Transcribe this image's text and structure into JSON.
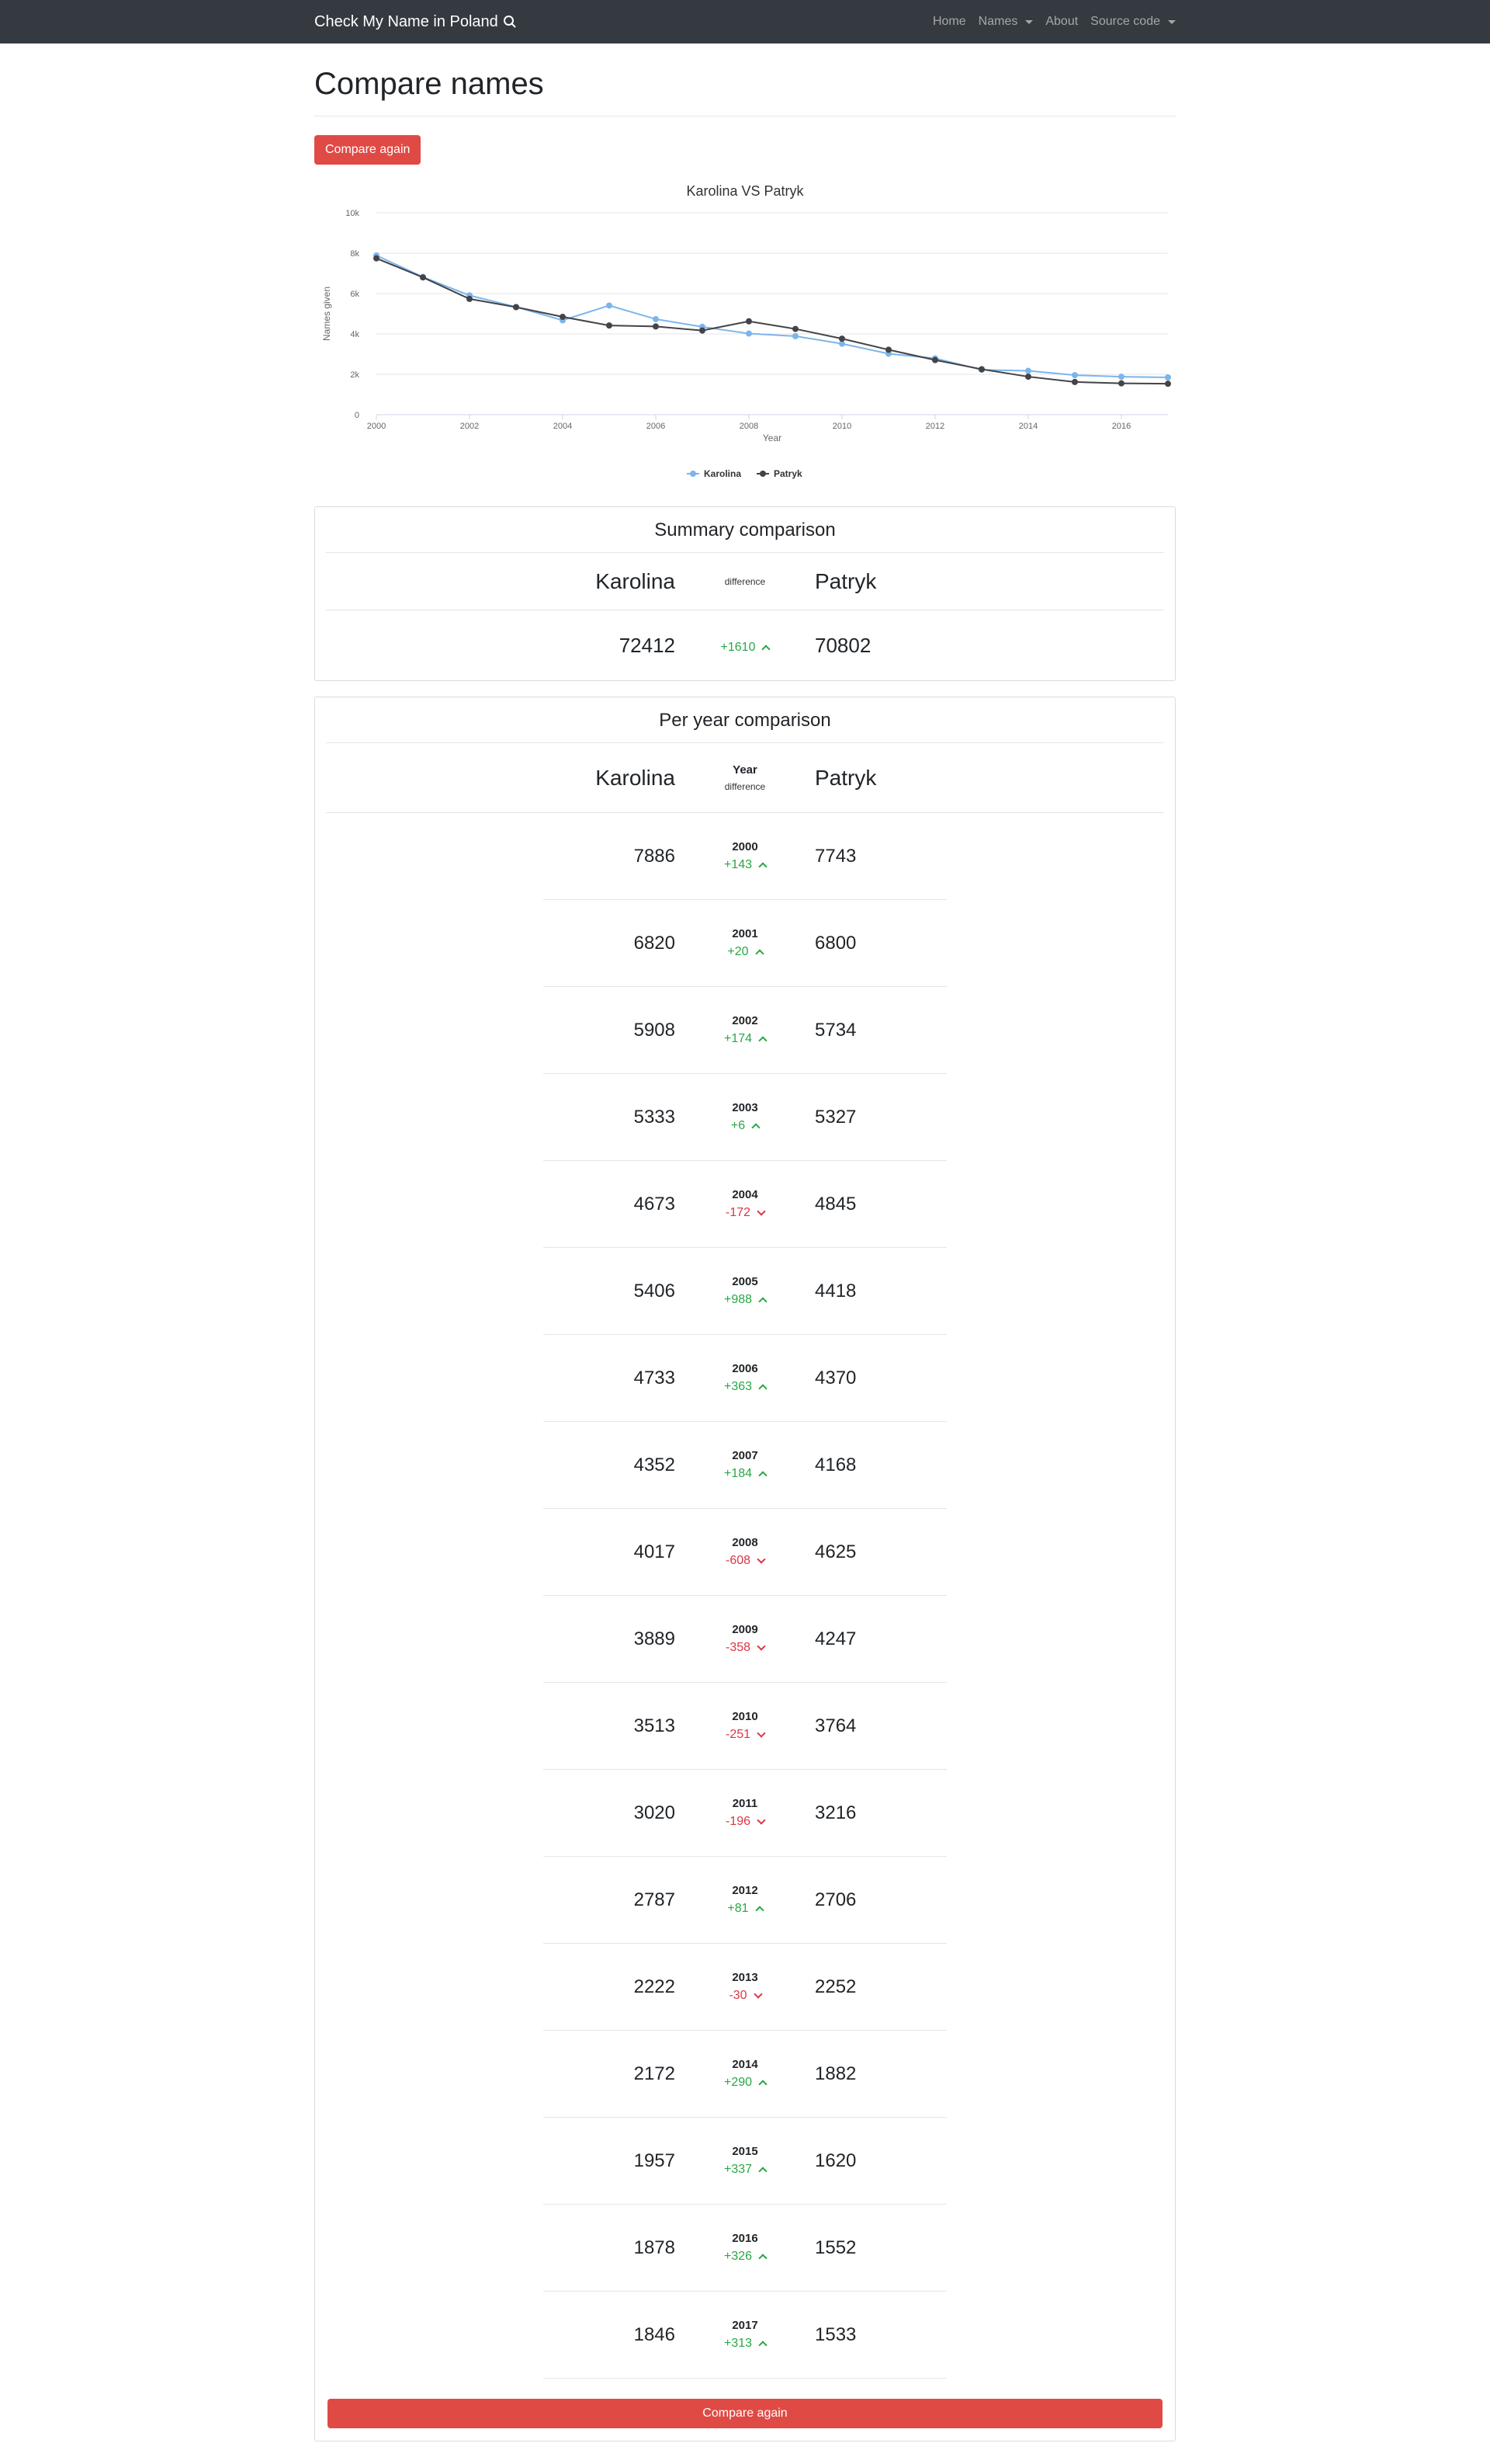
{
  "navbar": {
    "brand": "Check My Name in Poland",
    "links": [
      "Home",
      "Names",
      "About",
      "Source code"
    ]
  },
  "page": {
    "title": "Compare names",
    "compare_again": "Compare again",
    "compare_again_bottom": "Compare again"
  },
  "chart_data": {
    "type": "line",
    "title": "Karolina VS Patryk",
    "xlabel": "Year",
    "ylabel": "Names given",
    "x": [
      2000,
      2001,
      2002,
      2003,
      2004,
      2005,
      2006,
      2007,
      2008,
      2009,
      2010,
      2011,
      2012,
      2013,
      2014,
      2015,
      2016,
      2017
    ],
    "x_ticks": [
      "2000",
      "2002",
      "2004",
      "2006",
      "2008",
      "2010",
      "2012",
      "2014",
      "2016"
    ],
    "y_ticks": [
      "0",
      "2k",
      "4k",
      "6k",
      "8k",
      "10k"
    ],
    "ylim": [
      0,
      10000
    ],
    "legend_position": "bottom",
    "series": [
      {
        "name": "Karolina",
        "color": "#7cb5ec",
        "values": [
          7886,
          6820,
          5908,
          5333,
          4673,
          5406,
          4733,
          4352,
          4017,
          3889,
          3513,
          3020,
          2787,
          2222,
          2172,
          1957,
          1878,
          1846
        ]
      },
      {
        "name": "Patryk",
        "color": "#434348",
        "values": [
          7743,
          6800,
          5734,
          5327,
          4845,
          4418,
          4370,
          4168,
          4625,
          4247,
          3764,
          3216,
          2706,
          2252,
          1882,
          1620,
          1552,
          1533
        ]
      }
    ]
  },
  "summary": {
    "title": "Summary comparison",
    "name_left": "Karolina",
    "name_right": "Patryk",
    "diff_label": "difference",
    "left_total": "72412",
    "right_total": "70802",
    "diff": "+1610"
  },
  "per_year": {
    "title": "Per year comparison",
    "name_left": "Karolina",
    "name_right": "Patryk",
    "year_label": "Year",
    "diff_label": "difference",
    "rows": [
      {
        "year": "2000",
        "left": "7886",
        "right": "7743",
        "diff": "+143",
        "dir": "up"
      },
      {
        "year": "2001",
        "left": "6820",
        "right": "6800",
        "diff": "+20",
        "dir": "up"
      },
      {
        "year": "2002",
        "left": "5908",
        "right": "5734",
        "diff": "+174",
        "dir": "up"
      },
      {
        "year": "2003",
        "left": "5333",
        "right": "5327",
        "diff": "+6",
        "dir": "up"
      },
      {
        "year": "2004",
        "left": "4673",
        "right": "4845",
        "diff": "-172",
        "dir": "down"
      },
      {
        "year": "2005",
        "left": "5406",
        "right": "4418",
        "diff": "+988",
        "dir": "up"
      },
      {
        "year": "2006",
        "left": "4733",
        "right": "4370",
        "diff": "+363",
        "dir": "up"
      },
      {
        "year": "2007",
        "left": "4352",
        "right": "4168",
        "diff": "+184",
        "dir": "up"
      },
      {
        "year": "2008",
        "left": "4017",
        "right": "4625",
        "diff": "-608",
        "dir": "down"
      },
      {
        "year": "2009",
        "left": "3889",
        "right": "4247",
        "diff": "-358",
        "dir": "down"
      },
      {
        "year": "2010",
        "left": "3513",
        "right": "3764",
        "diff": "-251",
        "dir": "down"
      },
      {
        "year": "2011",
        "left": "3020",
        "right": "3216",
        "diff": "-196",
        "dir": "down"
      },
      {
        "year": "2012",
        "left": "2787",
        "right": "2706",
        "diff": "+81",
        "dir": "up"
      },
      {
        "year": "2013",
        "left": "2222",
        "right": "2252",
        "diff": "-30",
        "dir": "down"
      },
      {
        "year": "2014",
        "left": "2172",
        "right": "1882",
        "diff": "+290",
        "dir": "up"
      },
      {
        "year": "2015",
        "left": "1957",
        "right": "1620",
        "diff": "+337",
        "dir": "up"
      },
      {
        "year": "2016",
        "left": "1878",
        "right": "1552",
        "diff": "+326",
        "dir": "up"
      },
      {
        "year": "2017",
        "left": "1846",
        "right": "1533",
        "diff": "+313",
        "dir": "up"
      }
    ]
  }
}
